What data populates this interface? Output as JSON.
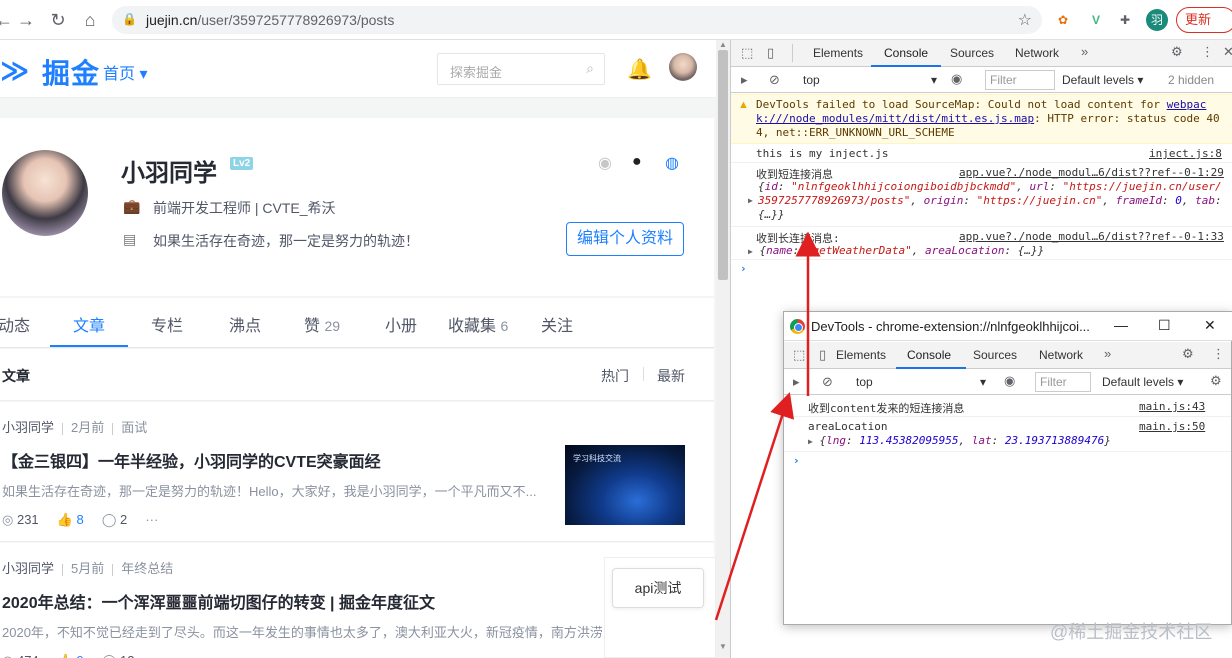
{
  "browser": {
    "url_host": "juejin.cn",
    "url_path": "/user/3597257778926973/posts",
    "profile_initial": "羽",
    "update_label": "更新"
  },
  "juejin": {
    "logo_text": "掘金",
    "home_label": "首页",
    "search_placeholder": "探索掘金",
    "profile": {
      "name": "小羽同学",
      "level": "Lv2",
      "job": "前端开发工程师 | CVTE_希沃",
      "motto": "如果生活存在奇迹，那一定是努力的轨迹！",
      "edit_button": "编辑个人资料"
    },
    "tabs": [
      {
        "label": "动态",
        "count": ""
      },
      {
        "label": "文章",
        "count": ""
      },
      {
        "label": "专栏",
        "count": ""
      },
      {
        "label": "沸点",
        "count": ""
      },
      {
        "label": "赞",
        "count": "29"
      },
      {
        "label": "小册",
        "count": ""
      },
      {
        "label": "收藏集",
        "count": "6"
      },
      {
        "label": "关注",
        "count": ""
      }
    ],
    "list": {
      "title": "文章",
      "sort_hot": "热门",
      "sort_new": "最新"
    },
    "articles": [
      {
        "author": "小羽同学",
        "time": "2月前",
        "tag": "面试",
        "title": "【金三银四】一年半经验，小羽同学的CVTE突豪面经",
        "desc": "如果生活存在奇迹，那一定是努力的轨迹！Hello，大家好，我是小羽同学，一个平凡而又不...",
        "views": "231",
        "likes": "8",
        "comments": "2",
        "more": "···",
        "thumb_text": "学习科技交流"
      },
      {
        "author": "小羽同学",
        "time": "5月前",
        "tag": "年终总结",
        "title": "2020年总结：一个浑浑噩噩前端切图仔的转变 | 掘金年度征文",
        "desc": "2020年，不知不觉已经走到了尽头。而这一年发生的事情也太多了，澳大利亚大火，新冠疫情，南方洪涝",
        "views": "474",
        "likes": "9",
        "comments": "12"
      }
    ],
    "api_test_button": "api测试"
  },
  "devtools": {
    "tabs": [
      "Elements",
      "Console",
      "Sources",
      "Network"
    ],
    "context": "top",
    "filter_placeholder": "Filter",
    "levels": "Default levels",
    "hidden": "2 hidden",
    "warning": {
      "prefix": "DevTools failed to load SourceMap: Could not load content for ",
      "link": "webpack:///node_modules/mitt/dist/mitt.es.js.map",
      "suffix": ": HTTP error: status code 404, net::ERR_UNKNOWN_URL_SCHEME"
    },
    "logs": [
      {
        "text": "this is my inject.js",
        "source": "inject.js:8"
      },
      {
        "text": "收到短连接消息",
        "source": "app.vue?./node_modul…6/dist??ref--0-1:29"
      },
      {
        "text": "收到长连接消息:",
        "source": "app.vue?./node_modul…6/dist??ref--0-1:33"
      }
    ],
    "obj1": {
      "id_key": "id",
      "id_val": "\"nlnfgeoklhhijcoiongiboidbjbckmdd\"",
      "url_key": "url",
      "url_val": "\"https://juejin.cn/user/3597257778926973/posts\"",
      "origin_key": "origin",
      "origin_val": "\"https://juejin.cn\"",
      "frame_key": "frameId",
      "frame_val": "0",
      "tab_key": "tab",
      "tab_val": "{…}"
    },
    "obj2": {
      "name_key": "name",
      "name_val": "\"getWeatherData\"",
      "area_key": "areaLocation",
      "area_val": "{…}"
    }
  },
  "popup": {
    "title": "DevTools - chrome-extension://nlnfgeoklhhijcoi...",
    "tabs": [
      "Elements",
      "Console",
      "Sources",
      "Network"
    ],
    "context": "top",
    "filter_placeholder": "Filter",
    "levels": "Default levels",
    "logs": [
      {
        "text": "收到content发来的短连接消息",
        "source": "main.js:43"
      },
      {
        "text": "areaLocation",
        "source": "main.js:50"
      }
    ],
    "obj": {
      "lng_key": "lng",
      "lng_val": "113.45382095955",
      "lat_key": "lat",
      "lat_val": "23.193713889476"
    }
  },
  "watermark": "@稀土掘金技术社区",
  "colors": {
    "accent": "#1e80ff",
    "arrow": "#e02020"
  }
}
